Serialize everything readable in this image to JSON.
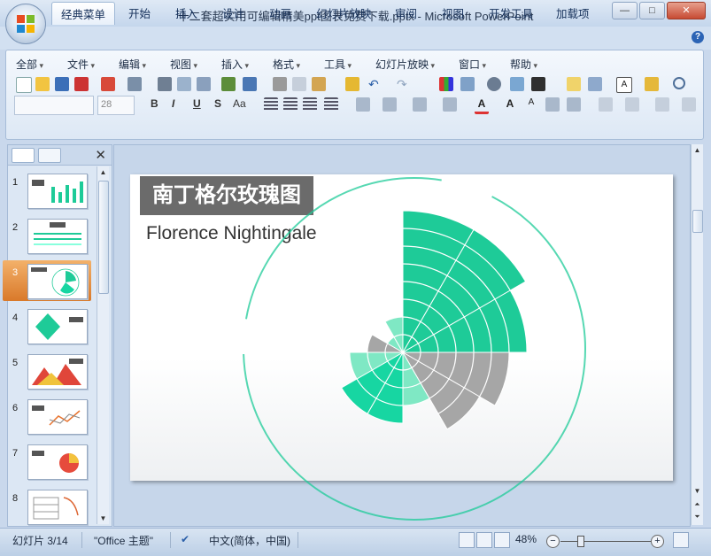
{
  "window": {
    "title": "十二套超实用可编辑精美ppt图表免费下载.pptx - Microsoft PowerPoint",
    "minimize": "—",
    "maximize": "□",
    "close": "✕"
  },
  "ribbon_tabs": [
    "经典菜单",
    "开始",
    "插入",
    "设计",
    "动画",
    "幻灯片放映",
    "审阅",
    "视图",
    "开发工具",
    "加载项"
  ],
  "menu_items": [
    "全部",
    "文件",
    "编辑",
    "视图",
    "插入",
    "格式",
    "工具",
    "幻灯片放映",
    "窗口",
    "帮助"
  ],
  "font_size": "28",
  "format_buttons": [
    "B",
    "I",
    "U",
    "S",
    "Aa"
  ],
  "help_label": "?",
  "left_pane": {
    "close_label": "✕",
    "slide_numbers": [
      "1",
      "2",
      "3",
      "4",
      "5",
      "6",
      "7",
      "8"
    ],
    "selected_index": 3
  },
  "slide": {
    "title": "南丁格尔玫瑰图",
    "subtitle": "Florence Nightingale"
  },
  "chart_data": {
    "type": "rose",
    "rings": 8,
    "colors": {
      "green": "#1ecb98",
      "light_green": "#7fe8c4",
      "gray": "#a6a6a6",
      "teal": "#17d6a2"
    },
    "sectors": [
      {
        "start_deg": 0,
        "end_deg": 30,
        "rings": 8,
        "color": "green"
      },
      {
        "start_deg": 30,
        "end_deg": 60,
        "rings": 8,
        "color": "green"
      },
      {
        "start_deg": 60,
        "end_deg": 90,
        "rings": 7,
        "color": "green"
      },
      {
        "start_deg": 90,
        "end_deg": 120,
        "rings": 6,
        "color": "gray"
      },
      {
        "start_deg": 120,
        "end_deg": 150,
        "rings": 5,
        "color": "gray"
      },
      {
        "start_deg": 150,
        "end_deg": 180,
        "rings": 3,
        "color": "light_green"
      },
      {
        "start_deg": 180,
        "end_deg": 210,
        "rings": 4,
        "color": "teal"
      },
      {
        "start_deg": 210,
        "end_deg": 240,
        "rings": 4,
        "color": "teal"
      },
      {
        "start_deg": 240,
        "end_deg": 270,
        "rings": 3,
        "color": "light_green"
      },
      {
        "start_deg": 270,
        "end_deg": 300,
        "rings": 2,
        "color": "gray"
      },
      {
        "start_deg": 300,
        "end_deg": 330,
        "rings": 1,
        "color": "light_green"
      },
      {
        "start_deg": 330,
        "end_deg": 360,
        "rings": 2,
        "color": "light_green"
      }
    ]
  },
  "status": {
    "slide_info": "幻灯片 3/14",
    "theme": "\"Office 主题\"",
    "language": "中文(简体，中国)",
    "zoom": "48%",
    "zoom_minus": "−",
    "zoom_plus": "+"
  }
}
